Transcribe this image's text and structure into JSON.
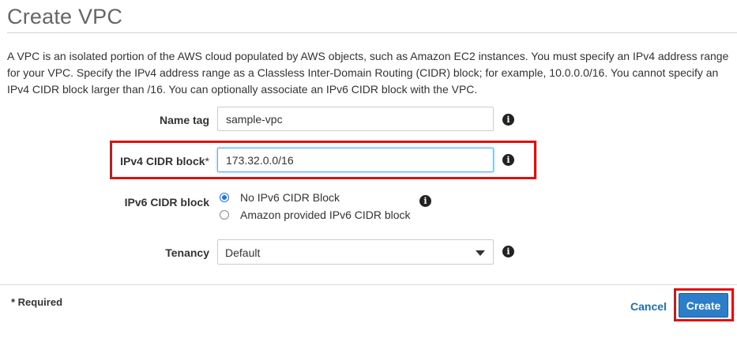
{
  "page": {
    "title": "Create VPC",
    "description": "A VPC is an isolated portion of the AWS cloud populated by AWS objects, such as Amazon EC2 instances. You must specify an IPv4 address range for your VPC. Specify the IPv4 address range as a Classless Inter-Domain Routing (CIDR) block; for example, 10.0.0.0/16. You cannot specify an IPv4 CIDR block larger than /16. You can optionally associate an IPv6 CIDR block with the VPC."
  },
  "form": {
    "name_tag": {
      "label": "Name tag",
      "value": "sample-vpc",
      "info_icon": "info-icon"
    },
    "ipv4_cidr": {
      "label": "IPv4 CIDR block",
      "required_marker": "*",
      "value": "173.32.0.0/16",
      "info_icon": "info-icon"
    },
    "ipv6_cidr": {
      "label": "IPv6 CIDR block",
      "options": [
        {
          "label": "No IPv6 CIDR Block",
          "checked": true
        },
        {
          "label": "Amazon provided IPv6 CIDR block",
          "checked": false
        }
      ],
      "info_icon": "info-icon"
    },
    "tenancy": {
      "label": "Tenancy",
      "selected": "Default",
      "info_icon": "info-icon"
    }
  },
  "footer": {
    "required_note": "* Required",
    "cancel_label": "Cancel",
    "create_label": "Create"
  },
  "icons": {
    "info_glyph": "i"
  },
  "colors": {
    "highlight": "#e01010",
    "primary_button": "#2d7ec8",
    "link": "#1f6fb5",
    "radio_selected": "#1a73e8"
  }
}
